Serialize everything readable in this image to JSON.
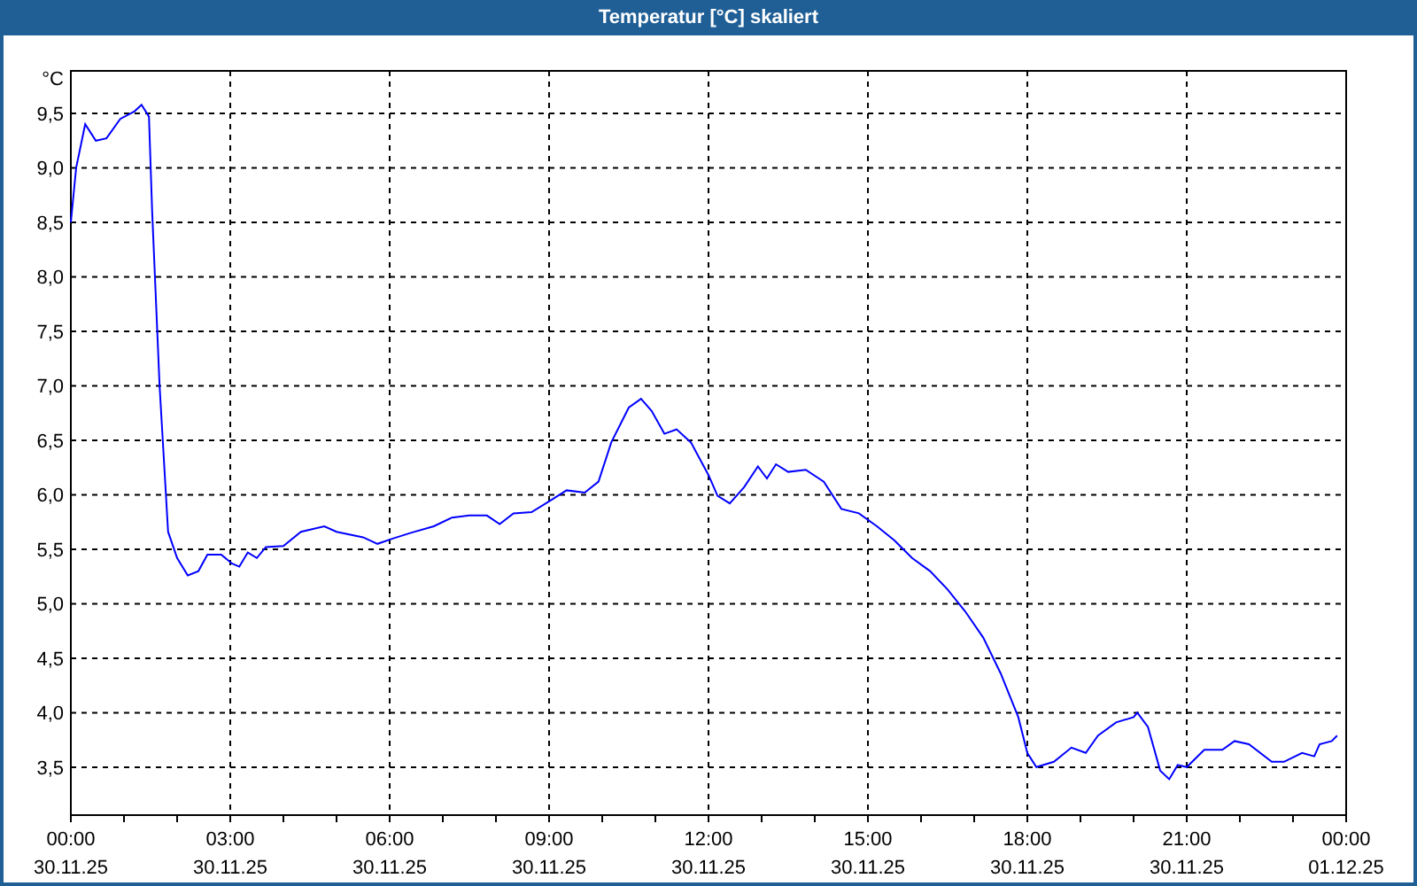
{
  "window": {
    "title": "Temperatur [°C] skaliert"
  },
  "chart": {
    "x_axis_dates": [
      "30.11.25",
      "30.11.25",
      "30.11.25",
      "30.11.25",
      "30.11.25",
      "30.11.25",
      "30.11.25",
      "30.11.25",
      "01.12.25"
    ],
    "chart_data": {
      "type": "line",
      "ylabel": "°C",
      "grid": true,
      "xlim": [
        0,
        24
      ],
      "ylim": [
        3.06,
        9.89
      ],
      "yticks": [
        {
          "value": 3.5,
          "label": "3,5"
        },
        {
          "value": 4,
          "label": "4,0"
        },
        {
          "value": 4.5,
          "label": "4,5"
        },
        {
          "value": 5,
          "label": "5,0"
        },
        {
          "value": 5.5,
          "label": "5,5"
        },
        {
          "value": 6,
          "label": "6,0"
        },
        {
          "value": 6.5,
          "label": "6,5"
        },
        {
          "value": 7,
          "label": "7,0"
        },
        {
          "value": 7.5,
          "label": "7,5"
        },
        {
          "value": 8,
          "label": "8,0"
        },
        {
          "value": 8.5,
          "label": "8,5"
        },
        {
          "value": 9,
          "label": "9,0"
        },
        {
          "value": 9.5,
          "label": "9,5"
        }
      ],
      "xticks": [
        {
          "value": 0,
          "label": "00:00"
        },
        {
          "value": 3,
          "label": "03:00"
        },
        {
          "value": 6,
          "label": "06:00"
        },
        {
          "value": 9,
          "label": "09:00"
        },
        {
          "value": 12,
          "label": "12:00"
        },
        {
          "value": 15,
          "label": "15:00"
        },
        {
          "value": 18,
          "label": "18:00"
        },
        {
          "value": 21,
          "label": "21:00"
        },
        {
          "value": 24,
          "label": "00:00"
        }
      ],
      "x": [
        0,
        0.1,
        0.27,
        0.47,
        0.67,
        0.93,
        1.2,
        1.33,
        1.47,
        1.53,
        1.67,
        1.83,
        2.0,
        2.2,
        2.4,
        2.57,
        2.83,
        3.03,
        3.17,
        3.33,
        3.5,
        3.67,
        4.0,
        4.33,
        4.77,
        5.0,
        5.5,
        5.77,
        6.07,
        6.4,
        6.83,
        7.17,
        7.5,
        7.83,
        8.07,
        8.33,
        8.67,
        9.0,
        9.33,
        9.67,
        9.93,
        10.17,
        10.5,
        10.73,
        10.93,
        11.17,
        11.4,
        11.67,
        12.0,
        12.17,
        12.4,
        12.67,
        12.93,
        13.1,
        13.27,
        13.5,
        13.83,
        14.17,
        14.5,
        14.83,
        15.17,
        15.5,
        15.83,
        16.17,
        16.5,
        16.83,
        17.17,
        17.5,
        17.83,
        18.0,
        18.17,
        18.5,
        18.83,
        19.1,
        19.33,
        19.67,
        20.0,
        20.07,
        20.27,
        20.5,
        20.67,
        20.83,
        21.0,
        21.33,
        21.67,
        21.9,
        22.17,
        22.6,
        22.83,
        23.17,
        23.4,
        23.5,
        23.73,
        23.83
      ],
      "series": [
        {
          "color": "#0000ff",
          "values": [
            8.5,
            9.0,
            9.4,
            9.25,
            9.27,
            9.45,
            9.52,
            9.58,
            9.47,
            8.6,
            7.0,
            5.66,
            5.42,
            5.26,
            5.3,
            5.45,
            5.45,
            5.37,
            5.34,
            5.47,
            5.42,
            5.52,
            5.53,
            5.66,
            5.71,
            5.66,
            5.61,
            5.55,
            5.6,
            5.65,
            5.71,
            5.79,
            5.81,
            5.81,
            5.73,
            5.83,
            5.84,
            5.94,
            6.04,
            6.02,
            6.12,
            6.48,
            6.8,
            6.88,
            6.77,
            6.56,
            6.6,
            6.48,
            6.18,
            5.99,
            5.92,
            6.07,
            6.26,
            6.15,
            6.28,
            6.21,
            6.23,
            6.12,
            5.87,
            5.83,
            5.71,
            5.58,
            5.42,
            5.3,
            5.13,
            4.93,
            4.69,
            4.36,
            3.96,
            3.63,
            3.5,
            3.55,
            3.68,
            3.63,
            3.79,
            3.91,
            3.96,
            4.0,
            3.87,
            3.47,
            3.39,
            3.52,
            3.5,
            3.66,
            3.66,
            3.74,
            3.71,
            3.55,
            3.55,
            3.63,
            3.6,
            3.71,
            3.74,
            3.79
          ]
        }
      ]
    }
  }
}
